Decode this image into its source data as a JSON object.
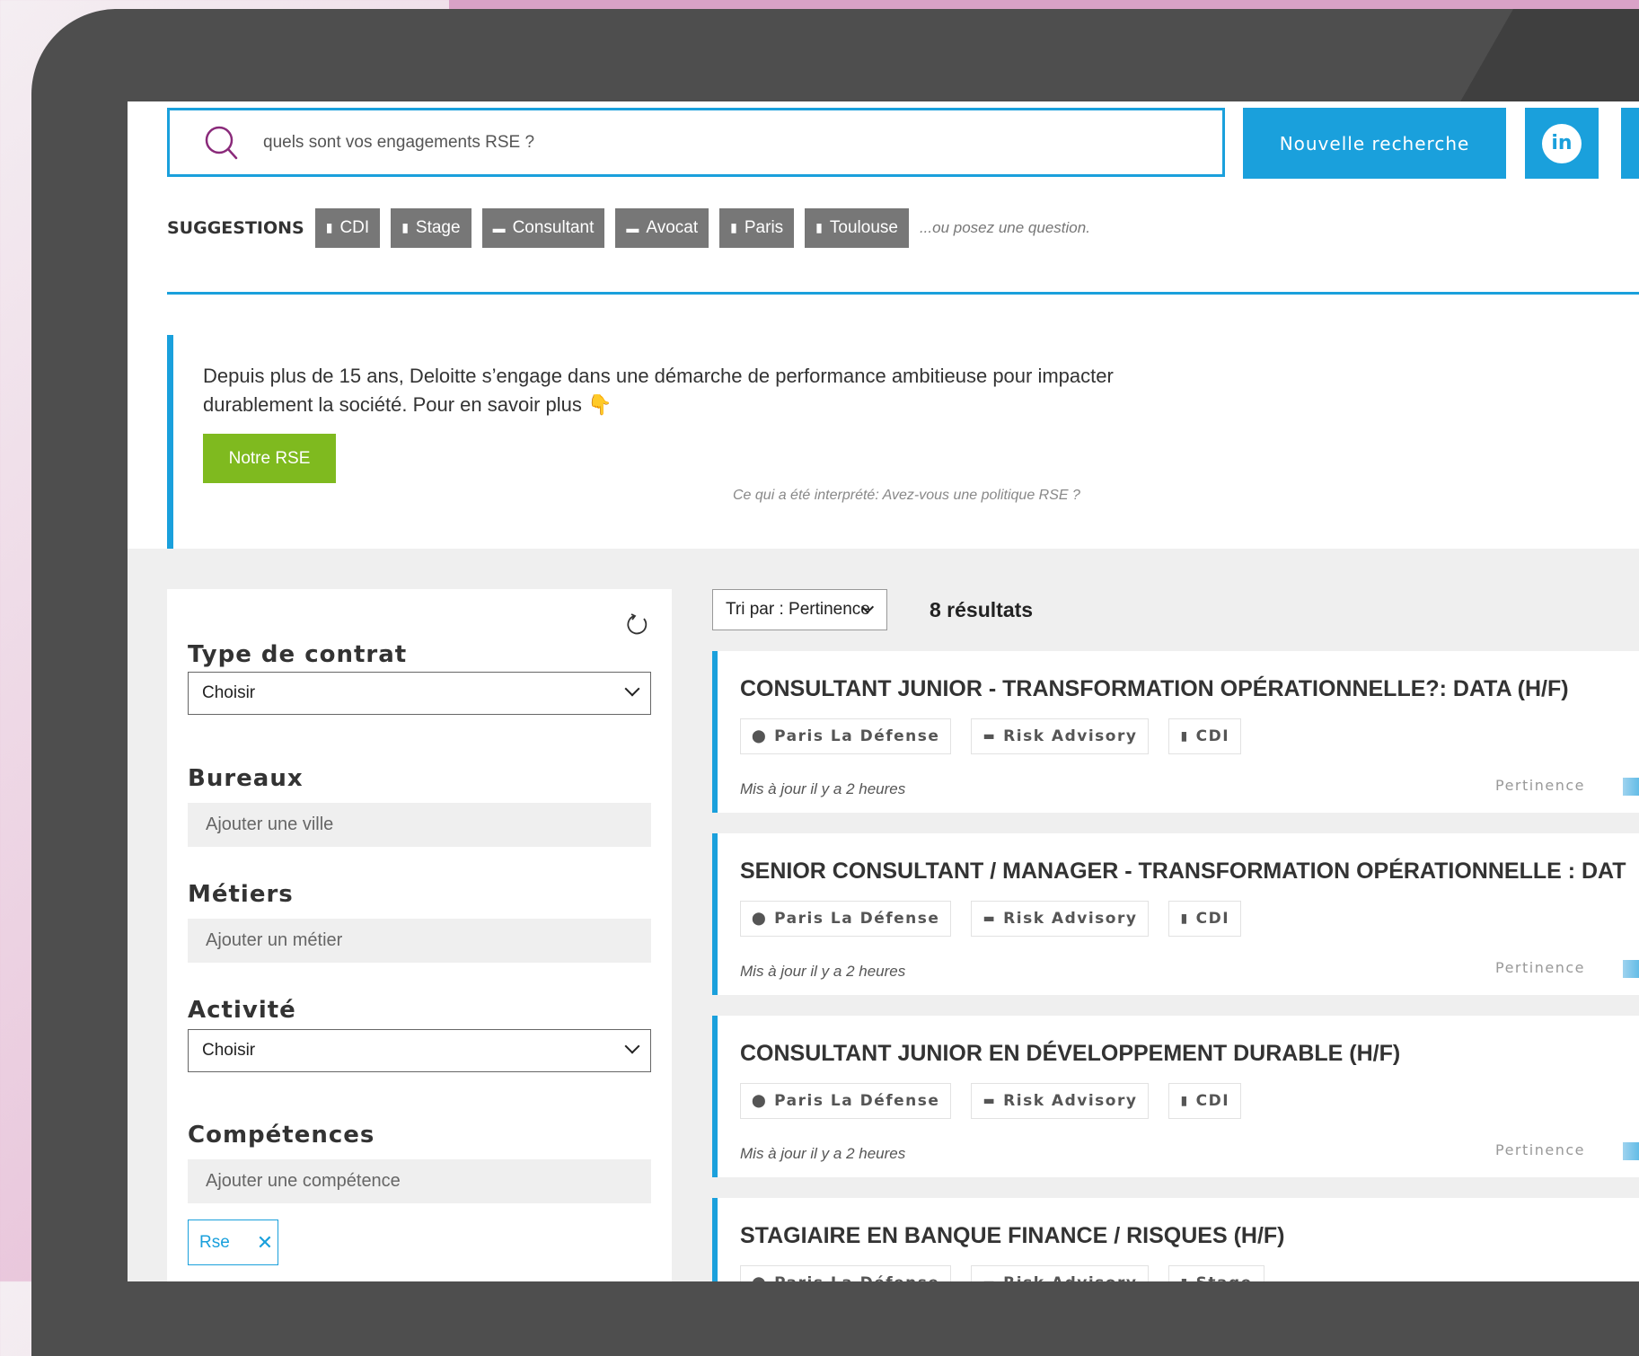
{
  "search": {
    "value": "quels sont vos engagements RSE ?"
  },
  "header": {
    "new_search_label": "Nouvelle recherche",
    "linkedin_label": "in"
  },
  "suggestions": {
    "label": "SUGGESTIONS",
    "chips": [
      {
        "label": "CDI",
        "icon": "document-icon"
      },
      {
        "label": "Stage",
        "icon": "document-icon"
      },
      {
        "label": "Consultant",
        "icon": "briefcase-icon"
      },
      {
        "label": "Avocat",
        "icon": "briefcase-icon"
      },
      {
        "label": "Paris",
        "icon": "document-icon"
      },
      {
        "label": "Toulouse",
        "icon": "document-icon"
      }
    ],
    "hint": "...ou posez une question."
  },
  "rse": {
    "text": "Depuis plus de 15 ans, Deloitte s’engage dans une démarche de performance ambitieuse pour impacter durablement la société. Pour en savoir plus 👇",
    "button_label": "Notre RSE",
    "interpretation": "Ce qui a été interprété: Avez-vous une politique RSE ?"
  },
  "filters": {
    "contract_label": "Type de contrat",
    "contract_value": "Choisir",
    "offices_label": "Bureaux",
    "offices_placeholder": "Ajouter une ville",
    "jobs_label": "Métiers",
    "jobs_placeholder": "Ajouter un métier",
    "activity_label": "Activité",
    "activity_value": "Choisir",
    "skills_label": "Compétences",
    "skills_placeholder": "Ajouter une compétence",
    "skill_tag": "Rse"
  },
  "results": {
    "sort_label": "Tri par : Pertinence",
    "count_label": "8 résultats",
    "items": [
      {
        "title": "CONSULTANT JUNIOR - TRANSFORMATION OPÉRATIONNELLE?: DATA (H/F)",
        "location": "Paris La Défense",
        "department": "Risk Advisory",
        "contract": "CDI",
        "updated": "Mis à jour il y a 2 heures",
        "relevance_label": "Pertinence"
      },
      {
        "title": "SENIOR CONSULTANT / MANAGER - TRANSFORMATION OPÉRATIONNELLE : DAT",
        "location": "Paris La Défense",
        "department": "Risk Advisory",
        "contract": "CDI",
        "updated": "Mis à jour il y a 2 heures",
        "relevance_label": "Pertinence"
      },
      {
        "title": "CONSULTANT JUNIOR EN DÉVELOPPEMENT DURABLE (H/F)",
        "location": "Paris La Défense",
        "department": "Risk Advisory",
        "contract": "CDI",
        "updated": "Mis à jour il y a 2 heures",
        "relevance_label": "Pertinence"
      },
      {
        "title": "STAGIAIRE EN BANQUE FINANCE / RISQUES (H/F)",
        "location": "Paris La Défense",
        "department": "Risk Advisory",
        "contract": "Stage",
        "updated": "",
        "relevance_label": ""
      }
    ]
  },
  "colors": {
    "accent": "#1aa0dc",
    "green": "#7fba1f",
    "chip": "#777777",
    "bezel": "#4e4e4e"
  }
}
